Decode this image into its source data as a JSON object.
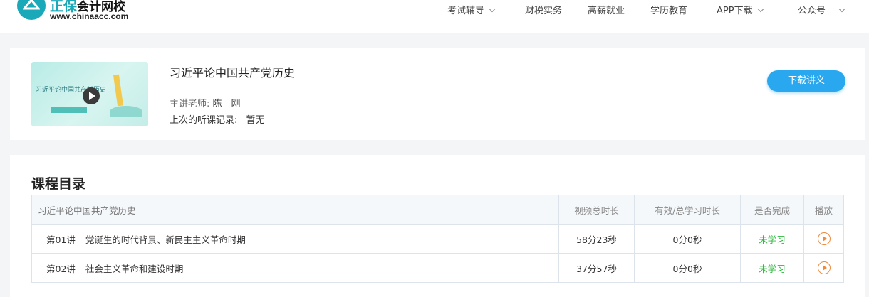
{
  "header": {
    "logo_brand": "正保",
    "logo_name": "会计网校",
    "logo_url": "www.chinaacc.com",
    "nav": [
      {
        "label": "考试辅导",
        "has_dropdown": true
      },
      {
        "label": "财税实务",
        "has_dropdown": false
      },
      {
        "label": "高薪就业",
        "has_dropdown": false
      },
      {
        "label": "学历教育",
        "has_dropdown": false
      },
      {
        "label": "APP下载",
        "has_dropdown": true
      },
      {
        "label": "公众号",
        "has_dropdown": true
      }
    ]
  },
  "course": {
    "title": "习近平论中国共产党历史",
    "thumbnail_title": "习近平论中国共产党历史",
    "teacher_label": "主讲老师:",
    "teacher": "陈　刚",
    "last_record_label": "上次的听课记录:",
    "last_record": "暂无",
    "download_label": "下载讲义"
  },
  "catalog": {
    "title": "课程目录",
    "columns": [
      "习近平论中国共产党历史",
      "视频总时长",
      "有效/总学习时长",
      "是否完成",
      "播放"
    ],
    "rows": [
      {
        "no": "第01讲",
        "name": "党诞生的时代背景、新民主主义革命时期",
        "duration": "58分23秒",
        "studied": "0分0秒",
        "status": "未学习"
      },
      {
        "no": "第02讲",
        "name": "社会主义革命和建设时期",
        "duration": "37分57秒",
        "studied": "0分0秒",
        "status": "未学习"
      }
    ]
  },
  "colors": {
    "accent": "#2aa8ef",
    "logo": "#1aa9b8",
    "status": "#2eb83d",
    "play": "#f08a3a"
  }
}
